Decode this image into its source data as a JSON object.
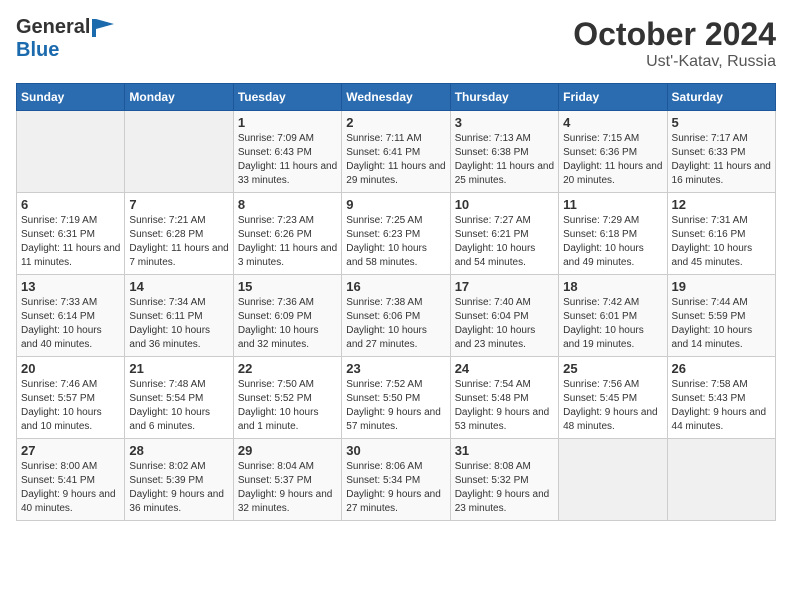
{
  "header": {
    "logo_general": "General",
    "logo_blue": "Blue",
    "title": "October 2024",
    "subtitle": "Ust'-Katav, Russia"
  },
  "weekdays": [
    "Sunday",
    "Monday",
    "Tuesday",
    "Wednesday",
    "Thursday",
    "Friday",
    "Saturday"
  ],
  "weeks": [
    [
      {
        "day": "",
        "sunrise": "",
        "sunset": "",
        "daylight": ""
      },
      {
        "day": "",
        "sunrise": "",
        "sunset": "",
        "daylight": ""
      },
      {
        "day": "1",
        "sunrise": "Sunrise: 7:09 AM",
        "sunset": "Sunset: 6:43 PM",
        "daylight": "Daylight: 11 hours and 33 minutes."
      },
      {
        "day": "2",
        "sunrise": "Sunrise: 7:11 AM",
        "sunset": "Sunset: 6:41 PM",
        "daylight": "Daylight: 11 hours and 29 minutes."
      },
      {
        "day": "3",
        "sunrise": "Sunrise: 7:13 AM",
        "sunset": "Sunset: 6:38 PM",
        "daylight": "Daylight: 11 hours and 25 minutes."
      },
      {
        "day": "4",
        "sunrise": "Sunrise: 7:15 AM",
        "sunset": "Sunset: 6:36 PM",
        "daylight": "Daylight: 11 hours and 20 minutes."
      },
      {
        "day": "5",
        "sunrise": "Sunrise: 7:17 AM",
        "sunset": "Sunset: 6:33 PM",
        "daylight": "Daylight: 11 hours and 16 minutes."
      }
    ],
    [
      {
        "day": "6",
        "sunrise": "Sunrise: 7:19 AM",
        "sunset": "Sunset: 6:31 PM",
        "daylight": "Daylight: 11 hours and 11 minutes."
      },
      {
        "day": "7",
        "sunrise": "Sunrise: 7:21 AM",
        "sunset": "Sunset: 6:28 PM",
        "daylight": "Daylight: 11 hours and 7 minutes."
      },
      {
        "day": "8",
        "sunrise": "Sunrise: 7:23 AM",
        "sunset": "Sunset: 6:26 PM",
        "daylight": "Daylight: 11 hours and 3 minutes."
      },
      {
        "day": "9",
        "sunrise": "Sunrise: 7:25 AM",
        "sunset": "Sunset: 6:23 PM",
        "daylight": "Daylight: 10 hours and 58 minutes."
      },
      {
        "day": "10",
        "sunrise": "Sunrise: 7:27 AM",
        "sunset": "Sunset: 6:21 PM",
        "daylight": "Daylight: 10 hours and 54 minutes."
      },
      {
        "day": "11",
        "sunrise": "Sunrise: 7:29 AM",
        "sunset": "Sunset: 6:18 PM",
        "daylight": "Daylight: 10 hours and 49 minutes."
      },
      {
        "day": "12",
        "sunrise": "Sunrise: 7:31 AM",
        "sunset": "Sunset: 6:16 PM",
        "daylight": "Daylight: 10 hours and 45 minutes."
      }
    ],
    [
      {
        "day": "13",
        "sunrise": "Sunrise: 7:33 AM",
        "sunset": "Sunset: 6:14 PM",
        "daylight": "Daylight: 10 hours and 40 minutes."
      },
      {
        "day": "14",
        "sunrise": "Sunrise: 7:34 AM",
        "sunset": "Sunset: 6:11 PM",
        "daylight": "Daylight: 10 hours and 36 minutes."
      },
      {
        "day": "15",
        "sunrise": "Sunrise: 7:36 AM",
        "sunset": "Sunset: 6:09 PM",
        "daylight": "Daylight: 10 hours and 32 minutes."
      },
      {
        "day": "16",
        "sunrise": "Sunrise: 7:38 AM",
        "sunset": "Sunset: 6:06 PM",
        "daylight": "Daylight: 10 hours and 27 minutes."
      },
      {
        "day": "17",
        "sunrise": "Sunrise: 7:40 AM",
        "sunset": "Sunset: 6:04 PM",
        "daylight": "Daylight: 10 hours and 23 minutes."
      },
      {
        "day": "18",
        "sunrise": "Sunrise: 7:42 AM",
        "sunset": "Sunset: 6:01 PM",
        "daylight": "Daylight: 10 hours and 19 minutes."
      },
      {
        "day": "19",
        "sunrise": "Sunrise: 7:44 AM",
        "sunset": "Sunset: 5:59 PM",
        "daylight": "Daylight: 10 hours and 14 minutes."
      }
    ],
    [
      {
        "day": "20",
        "sunrise": "Sunrise: 7:46 AM",
        "sunset": "Sunset: 5:57 PM",
        "daylight": "Daylight: 10 hours and 10 minutes."
      },
      {
        "day": "21",
        "sunrise": "Sunrise: 7:48 AM",
        "sunset": "Sunset: 5:54 PM",
        "daylight": "Daylight: 10 hours and 6 minutes."
      },
      {
        "day": "22",
        "sunrise": "Sunrise: 7:50 AM",
        "sunset": "Sunset: 5:52 PM",
        "daylight": "Daylight: 10 hours and 1 minute."
      },
      {
        "day": "23",
        "sunrise": "Sunrise: 7:52 AM",
        "sunset": "Sunset: 5:50 PM",
        "daylight": "Daylight: 9 hours and 57 minutes."
      },
      {
        "day": "24",
        "sunrise": "Sunrise: 7:54 AM",
        "sunset": "Sunset: 5:48 PM",
        "daylight": "Daylight: 9 hours and 53 minutes."
      },
      {
        "day": "25",
        "sunrise": "Sunrise: 7:56 AM",
        "sunset": "Sunset: 5:45 PM",
        "daylight": "Daylight: 9 hours and 48 minutes."
      },
      {
        "day": "26",
        "sunrise": "Sunrise: 7:58 AM",
        "sunset": "Sunset: 5:43 PM",
        "daylight": "Daylight: 9 hours and 44 minutes."
      }
    ],
    [
      {
        "day": "27",
        "sunrise": "Sunrise: 8:00 AM",
        "sunset": "Sunset: 5:41 PM",
        "daylight": "Daylight: 9 hours and 40 minutes."
      },
      {
        "day": "28",
        "sunrise": "Sunrise: 8:02 AM",
        "sunset": "Sunset: 5:39 PM",
        "daylight": "Daylight: 9 hours and 36 minutes."
      },
      {
        "day": "29",
        "sunrise": "Sunrise: 8:04 AM",
        "sunset": "Sunset: 5:37 PM",
        "daylight": "Daylight: 9 hours and 32 minutes."
      },
      {
        "day": "30",
        "sunrise": "Sunrise: 8:06 AM",
        "sunset": "Sunset: 5:34 PM",
        "daylight": "Daylight: 9 hours and 27 minutes."
      },
      {
        "day": "31",
        "sunrise": "Sunrise: 8:08 AM",
        "sunset": "Sunset: 5:32 PM",
        "daylight": "Daylight: 9 hours and 23 minutes."
      },
      {
        "day": "",
        "sunrise": "",
        "sunset": "",
        "daylight": ""
      },
      {
        "day": "",
        "sunrise": "",
        "sunset": "",
        "daylight": ""
      }
    ]
  ]
}
